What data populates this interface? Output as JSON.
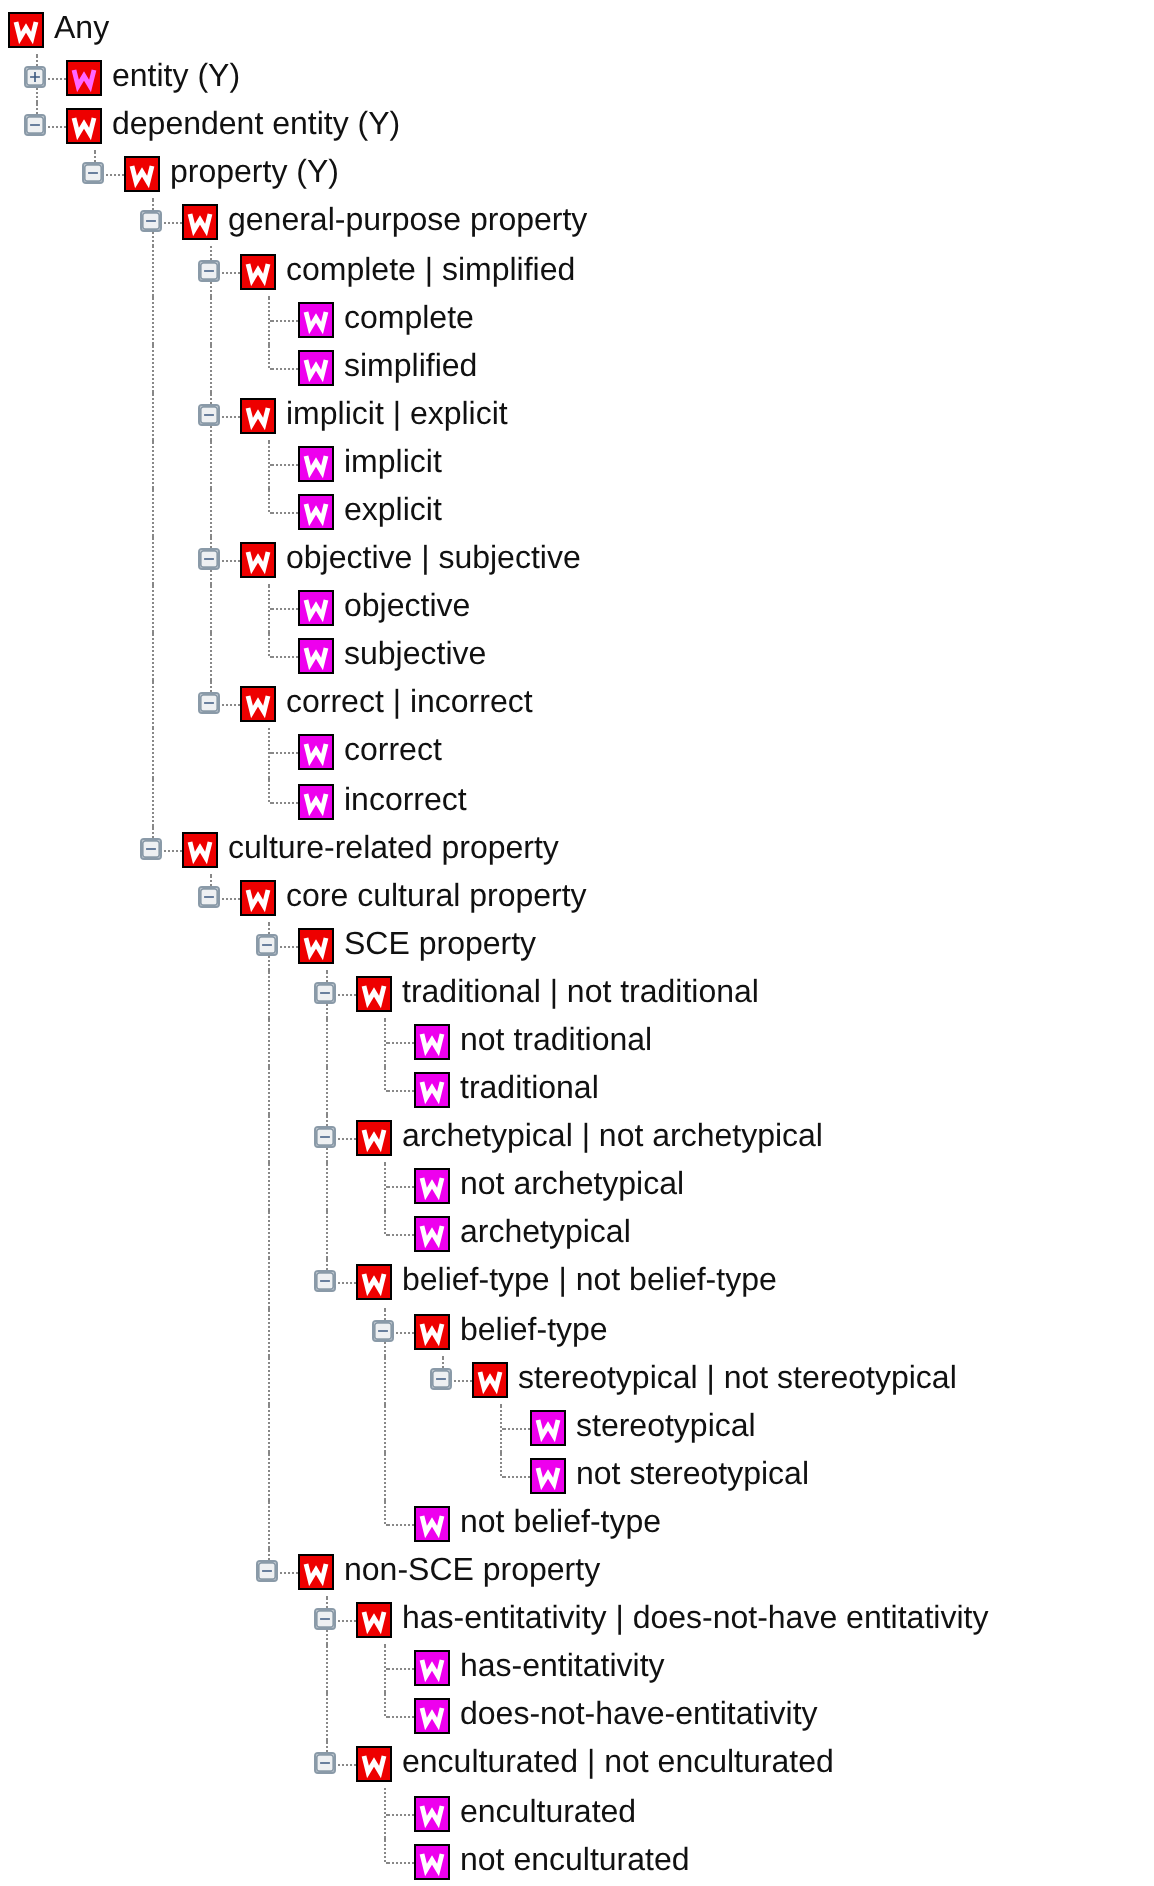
{
  "tree": {
    "label": "Any",
    "kind": "class",
    "children": [
      {
        "label": "entity (Y)",
        "kind": "class_alt",
        "expanded": false
      },
      {
        "label": "dependent entity (Y)",
        "kind": "class",
        "expanded": true,
        "children": [
          {
            "label": "property (Y)",
            "kind": "class",
            "expanded": true,
            "children": [
              {
                "label": "general-purpose property",
                "kind": "class",
                "expanded": true,
                "children": [
                  {
                    "label": "complete | simplified",
                    "kind": "class",
                    "expanded": true,
                    "children": [
                      {
                        "label": "complete",
                        "kind": "instance"
                      },
                      {
                        "label": "simplified",
                        "kind": "instance"
                      }
                    ]
                  },
                  {
                    "label": "implicit | explicit",
                    "kind": "class",
                    "expanded": true,
                    "children": [
                      {
                        "label": "implicit",
                        "kind": "instance"
                      },
                      {
                        "label": "explicit",
                        "kind": "instance"
                      }
                    ]
                  },
                  {
                    "label": "objective | subjective",
                    "kind": "class",
                    "expanded": true,
                    "children": [
                      {
                        "label": "objective",
                        "kind": "instance"
                      },
                      {
                        "label": "subjective",
                        "kind": "instance"
                      }
                    ]
                  },
                  {
                    "label": "correct | incorrect",
                    "kind": "class",
                    "expanded": true,
                    "children": [
                      {
                        "label": "correct",
                        "kind": "instance"
                      },
                      {
                        "label": "incorrect",
                        "kind": "instance"
                      }
                    ]
                  }
                ]
              },
              {
                "label": "culture-related property",
                "kind": "class",
                "expanded": true,
                "children": [
                  {
                    "label": "core cultural property",
                    "kind": "class",
                    "expanded": true,
                    "children": [
                      {
                        "label": "SCE property",
                        "kind": "class",
                        "expanded": true,
                        "children": [
                          {
                            "label": "traditional | not traditional",
                            "kind": "class",
                            "expanded": true,
                            "children": [
                              {
                                "label": "not traditional",
                                "kind": "instance"
                              },
                              {
                                "label": "traditional",
                                "kind": "instance"
                              }
                            ]
                          },
                          {
                            "label": "archetypical | not archetypical",
                            "kind": "class",
                            "expanded": true,
                            "children": [
                              {
                                "label": "not archetypical",
                                "kind": "instance"
                              },
                              {
                                "label": "archetypical",
                                "kind": "instance"
                              }
                            ]
                          },
                          {
                            "label": "belief-type | not belief-type",
                            "kind": "class",
                            "expanded": true,
                            "children": [
                              {
                                "label": "belief-type",
                                "kind": "class",
                                "expanded": true,
                                "children": [
                                  {
                                    "label": "stereotypical | not stereotypical",
                                    "kind": "class",
                                    "expanded": true,
                                    "children": [
                                      {
                                        "label": "stereotypical",
                                        "kind": "instance"
                                      },
                                      {
                                        "label": "not stereotypical",
                                        "kind": "instance"
                                      }
                                    ]
                                  }
                                ]
                              },
                              {
                                "label": "not belief-type",
                                "kind": "instance"
                              }
                            ]
                          }
                        ]
                      },
                      {
                        "label": "non-SCE property",
                        "kind": "class",
                        "expanded": true,
                        "children": [
                          {
                            "label": "has-entitativity | does-not-have entitativity",
                            "kind": "class",
                            "expanded": true,
                            "children": [
                              {
                                "label": "has-entitativity",
                                "kind": "instance"
                              },
                              {
                                "label": "does-not-have-entitativity",
                                "kind": "instance"
                              }
                            ]
                          },
                          {
                            "label": "enculturated | not enculturated",
                            "kind": "class",
                            "expanded": true,
                            "children": [
                              {
                                "label": "enculturated",
                                "kind": "instance"
                              },
                              {
                                "label": "not enculturated",
                                "kind": "instance"
                              }
                            ]
                          }
                        ]
                      }
                    ]
                  }
                ]
              }
            ]
          }
        ]
      }
    ]
  }
}
